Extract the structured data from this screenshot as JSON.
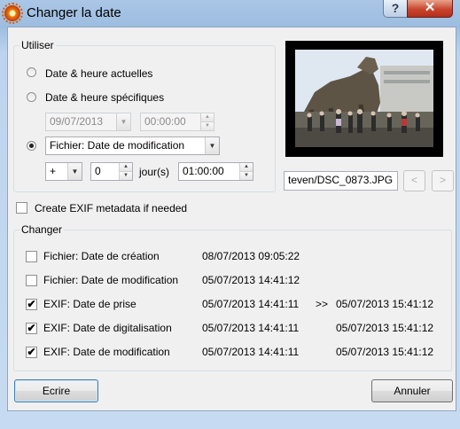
{
  "window": {
    "title": "Changer la date",
    "help_label": "?",
    "close_label": "✕"
  },
  "utiliser": {
    "legend": "Utiliser",
    "option_current": "Date & heure actuelles",
    "option_specific": "Date & heure spécifiques",
    "specific_date": "09/07/2013",
    "specific_time": "00:00:00",
    "file_source": "Fichier: Date de modification",
    "offset_sign": "+",
    "offset_days": "0",
    "days_label": "jour(s)",
    "offset_time": "01:00:00",
    "selected": "file_source"
  },
  "preview": {
    "filename": "teven/DSC_0873.JPG",
    "prev_label": "<",
    "next_label": ">"
  },
  "create_exif": {
    "label": "Create EXIF metadata if needed",
    "checked": false
  },
  "changer": {
    "legend": "Changer",
    "rows": [
      {
        "label": "Fichier: Date de création",
        "checked": false,
        "current": "08/07/2013 09:05:22",
        "arrow": "",
        "new": ""
      },
      {
        "label": "Fichier: Date de modification",
        "checked": false,
        "current": "05/07/2013 14:41:12",
        "arrow": "",
        "new": ""
      },
      {
        "label": "EXIF: Date de prise",
        "checked": true,
        "current": "05/07/2013 14:41:11",
        "arrow": ">>",
        "new": "05/07/2013 15:41:12"
      },
      {
        "label": "EXIF: Date de digitalisation",
        "checked": true,
        "current": "05/07/2013 14:41:11",
        "arrow": "",
        "new": "05/07/2013 15:41:12"
      },
      {
        "label": "EXIF: Date de modification",
        "checked": true,
        "current": "05/07/2013 14:41:11",
        "arrow": "",
        "new": "05/07/2013 15:41:12"
      }
    ]
  },
  "buttons": {
    "write": "Ecrire",
    "cancel": "Annuler"
  },
  "icons": {
    "check_mark": "✔",
    "dropdown_arrow": "▼",
    "spin_up": "▲",
    "spin_down": "▼"
  }
}
